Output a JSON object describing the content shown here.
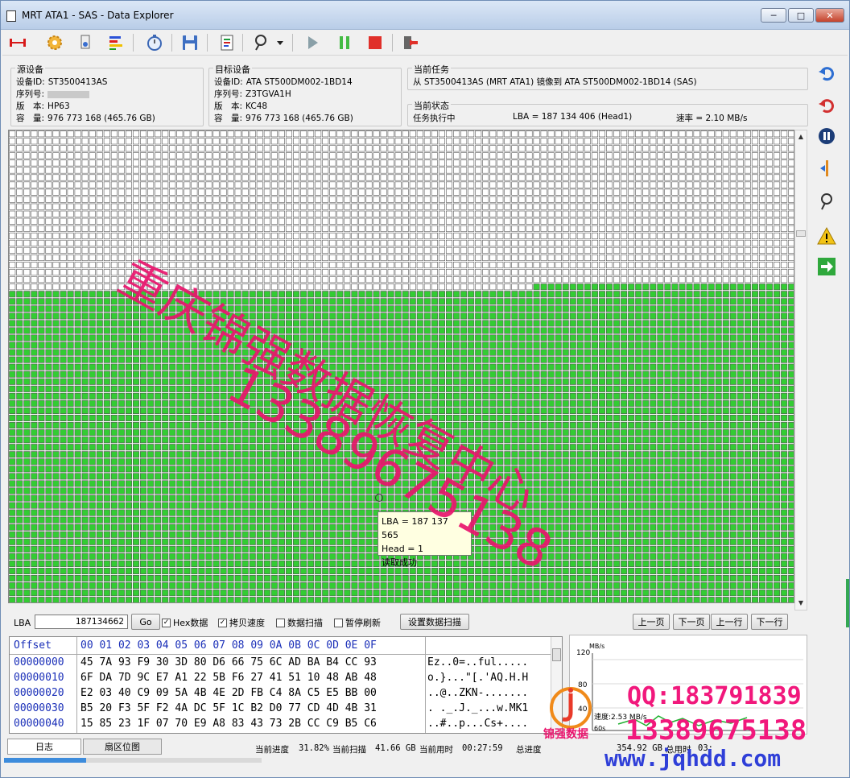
{
  "window": {
    "title": "MRT ATA1 - SAS - Data Explorer"
  },
  "source": {
    "label": "源设备",
    "id_label": "设备ID:",
    "id": "ST3500413AS",
    "serial_label": "序列号:",
    "version_label": "版　本:",
    "version": "HP63",
    "capacity_label": "容　量:",
    "capacity": "976 773 168 (465.76 GB)"
  },
  "target": {
    "label": "目标设备",
    "id_label": "设备ID:",
    "id": "ATA ST500DM002-1BD14",
    "serial_label": "序列号:",
    "serial": "Z3TGVA1H",
    "version_label": "版　本:",
    "version": "KC48",
    "capacity_label": "容　量:",
    "capacity": "976 773 168 (465.76 GB)"
  },
  "task": {
    "label": "当前任务",
    "text": "从 ST3500413AS (MRT ATA1) 镜像到 ATA ST500DM002-1BD14 (SAS)"
  },
  "status": {
    "label": "当前状态",
    "state": "任务执行中",
    "lba": "LBA = 187 134 406 (Head1)",
    "rate": "速率 = 2.10 MB/s"
  },
  "sector_map": {
    "total_rows": 65,
    "cols": 108,
    "read_full_rows": 21,
    "read_partial_cols": 72,
    "colors": {
      "read": "#33cc33",
      "unread": "#ffffff",
      "grid": "#555555"
    }
  },
  "tooltip": {
    "lba": "LBA = 187 137 565",
    "head": "Head = 1",
    "state": "读取成功"
  },
  "controls": {
    "lba_label": "LBA",
    "lba_value": "187134662",
    "go": "Go",
    "hex_label": "Hex数据",
    "copyspeed_label": "拷贝速度",
    "datascan_label": "数据扫描",
    "pause_label": "暂停刷新",
    "setup_scan": "设置数据扫描",
    "prev_page": "上一页",
    "next_page": "下一页",
    "prev_line": "上一行",
    "next_line": "下一行"
  },
  "hex": {
    "offset_header": "Offset",
    "col_header": "00 01 02 03 04 05 06 07 08 09 0A 0B 0C 0D 0E 0F",
    "rows": [
      {
        "offset": "00000000",
        "bytes": "45 7A 93 F9 30 3D 80 D6 66 75 6C AD BA B4 CC 93",
        "ascii": "Ez..0=..ful....."
      },
      {
        "offset": "00000010",
        "bytes": "6F DA 7D 9C E7 A1 22 5B F6 27 41 51 10 48 AB 48",
        "ascii": "o.}...\"[.'AQ.H.H"
      },
      {
        "offset": "00000020",
        "bytes": "E2 03 40 C9 09 5A 4B 4E 2D FB C4 8A C5 E5 BB 00",
        "ascii": "..@..ZKN-......."
      },
      {
        "offset": "00000030",
        "bytes": "B5 20 F3 5F F2 4A DC 5F 1C B2 D0 77 CD 4D 4B 31",
        "ascii": ". ._.J._...w.MK1"
      },
      {
        "offset": "00000040",
        "bytes": "15 85 23 1F 07 70 E9 A8 83 43 73 2B CC C9 B5 C6",
        "ascii": "..#..p...Cs+...."
      }
    ]
  },
  "speed_chart": {
    "unit": "MB/s",
    "ymax": "120",
    "ymid": "80",
    "ylow": "40",
    "readout": "速度:2.53 MB/s",
    "xlabel0": "60s"
  },
  "statusbar": {
    "tab_log": "日志",
    "tab_map": "扇区位图",
    "progress_pct": 31.82,
    "progress_label": "当前进度",
    "progress_value": "31.82%",
    "scan_label": "当前扫描",
    "scan_value": "41.66 GB",
    "time_label": "当前用时",
    "time_value": "00:27:59",
    "total_label": "总进度",
    "total_scan_value": "354.92 GB",
    "total_time_label": "总用时",
    "total_time_value": "03:"
  },
  "watermark": {
    "company": "重庆锦强数据恢复中心",
    "phone": "13389675138",
    "qq": "QQ:183791839",
    "phone2": "13389675138",
    "url": "www.jqhdd.com",
    "logo_text": "锦强数据"
  }
}
